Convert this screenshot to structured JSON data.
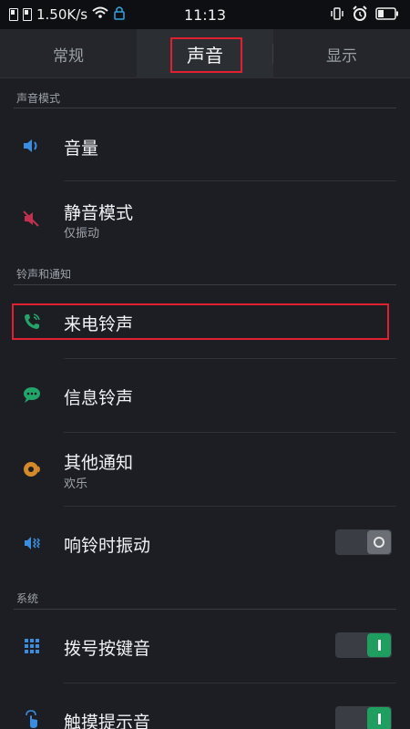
{
  "status_bar": {
    "speed": "1.50K/s",
    "time": "11:13"
  },
  "tabs": [
    {
      "label": "常规",
      "selected": false
    },
    {
      "label": "声音",
      "selected": true
    },
    {
      "label": "显示",
      "selected": false
    }
  ],
  "sections": {
    "sound_mode": "声音模式",
    "ringtone_notify": "铃声和通知",
    "system": "系统"
  },
  "items": {
    "volume": {
      "title": "音量",
      "icon": "speaker-icon"
    },
    "silent": {
      "title": "静音模式",
      "subtitle": "仅振动",
      "icon": "mute-icon"
    },
    "incoming": {
      "title": "来电铃声",
      "icon": "phone-ring-icon"
    },
    "message": {
      "title": "信息铃声",
      "icon": "message-icon"
    },
    "other": {
      "title": "其他通知",
      "subtitle": "欢乐",
      "icon": "notification-icon"
    },
    "vibrate": {
      "title": "响铃时振动",
      "icon": "vibrate-icon",
      "toggle": "off"
    },
    "dialpad": {
      "title": "拨号按键音",
      "icon": "dialpad-icon",
      "toggle": "on"
    },
    "touch": {
      "title": "触摸提示音",
      "icon": "touch-icon",
      "toggle": "on"
    }
  },
  "colors": {
    "accent_green": "#1e9e5f",
    "highlight_red": "#e02030",
    "background": "#1c1e23"
  }
}
